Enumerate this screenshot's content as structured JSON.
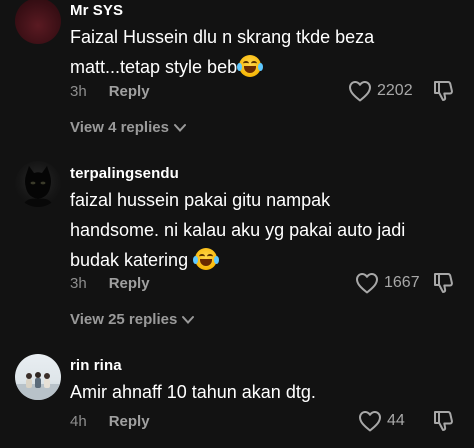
{
  "comments": [
    {
      "username": "Mr SYS",
      "line1": "Faizal Hussein dlu n skrang tkde beza",
      "line2": "matt...tetap style beb",
      "time": "3h",
      "reply_label": "Reply",
      "likes": "2202",
      "view_replies": "View 4 replies"
    },
    {
      "username": "terpalingsendu",
      "line1": "faizal hussein pakai gitu nampak",
      "line2": "handsome. ni kalau aku yg pakai auto jadi",
      "line3": "budak katering",
      "time": "3h",
      "reply_label": "Reply",
      "likes": "1667",
      "view_replies": "View 25 replies"
    },
    {
      "username": "rin rina",
      "line1": "Amir ahnaff 10 tahun akan dtg.",
      "time": "4h",
      "reply_label": "Reply",
      "likes": "44"
    }
  ],
  "icons": {
    "like": "heart-outline-icon",
    "dislike": "thumbs-down-outline-icon",
    "chevron": "chevron-down-icon",
    "emoji": "face-with-tears-of-joy-emoji"
  },
  "colors": {
    "background": "#121212",
    "primary_text": "#ffffff",
    "secondary_text": "#8e8e8e"
  }
}
